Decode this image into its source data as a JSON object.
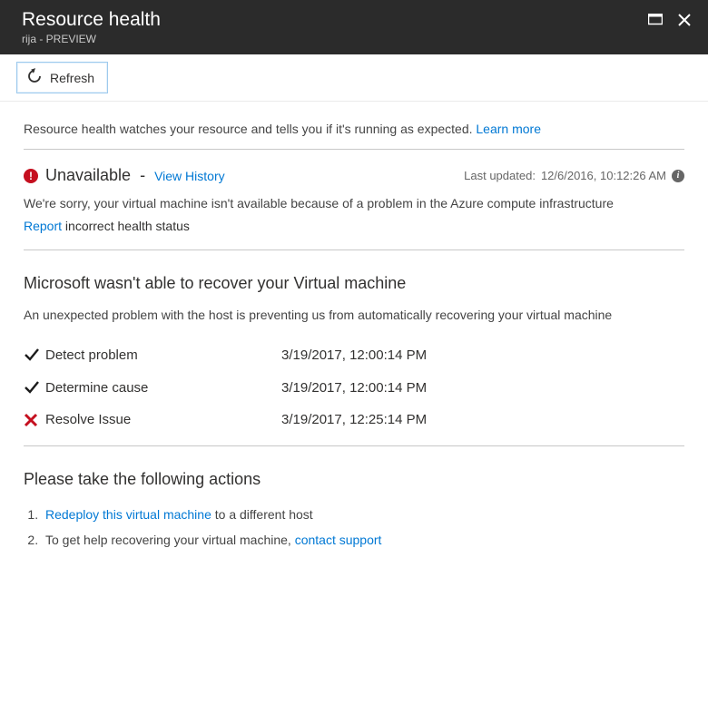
{
  "header": {
    "title": "Resource health",
    "subtitle": "rija - PREVIEW"
  },
  "toolbar": {
    "refresh_label": "Refresh"
  },
  "intro": {
    "text": "Resource health watches your resource and tells you if it's running as expected. ",
    "learn_more": "Learn more"
  },
  "status": {
    "state": "Unavailable",
    "view_history": "View History",
    "last_updated_label": "Last updated: ",
    "last_updated_value": "12/6/2016, 10:12:26 AM",
    "description": "We're sorry, your virtual machine isn't available because of a problem in the Azure compute infrastructure",
    "report_link": "Report",
    "report_suffix": " incorrect health status"
  },
  "recovery": {
    "title": "Microsoft wasn't able to recover your Virtual machine",
    "description": "An unexpected problem with the host is preventing us from automatically recovering your virtual machine",
    "steps": [
      {
        "label": "Detect problem",
        "timestamp": "3/19/2017, 12:00:14 PM",
        "status": "done"
      },
      {
        "label": "Determine cause",
        "timestamp": "3/19/2017, 12:00:14 PM",
        "status": "done"
      },
      {
        "label": "Resolve Issue",
        "timestamp": "3/19/2017, 12:25:14 PM",
        "status": "failed"
      }
    ]
  },
  "actions": {
    "title": "Please take the following actions",
    "items": [
      {
        "prefix": "",
        "link": "Redeploy this virtual machine",
        "suffix": " to a different host"
      },
      {
        "prefix": "To get help recovering your virtual machine, ",
        "link": "contact support",
        "suffix": ""
      }
    ]
  }
}
